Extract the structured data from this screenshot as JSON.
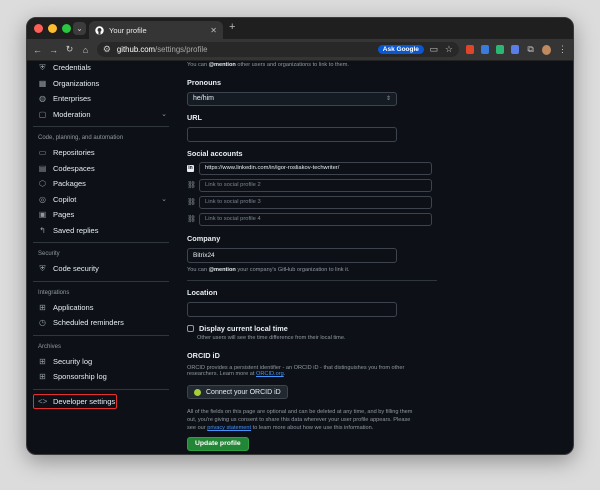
{
  "browser": {
    "tab_title": "Your profile",
    "url_host": "github.com",
    "url_path": "/settings/profile",
    "ask_google_label": "Ask Google"
  },
  "sidebar": {
    "top_items": [
      {
        "label": "Credentials",
        "icon": "shield-check-icon"
      },
      {
        "label": "Organizations",
        "icon": "organization-icon"
      },
      {
        "label": "Enterprises",
        "icon": "globe-icon"
      },
      {
        "label": "Moderation",
        "icon": "report-icon"
      }
    ],
    "heading_code": "Code, planning, and automation",
    "code_items": [
      {
        "label": "Repositories",
        "icon": "repo-icon"
      },
      {
        "label": "Codespaces",
        "icon": "codespaces-icon"
      },
      {
        "label": "Packages",
        "icon": "package-icon"
      },
      {
        "label": "Copilot",
        "icon": "copilot-icon"
      },
      {
        "label": "Pages",
        "icon": "browser-icon"
      },
      {
        "label": "Saved replies",
        "icon": "reply-icon"
      }
    ],
    "heading_security": "Security",
    "security_items": [
      {
        "label": "Code security",
        "icon": "shield-icon"
      }
    ],
    "heading_integrations": "Integrations",
    "integration_items": [
      {
        "label": "Applications",
        "icon": "apps-icon"
      },
      {
        "label": "Scheduled reminders",
        "icon": "clock-icon"
      }
    ],
    "heading_archives": "Archives",
    "archive_items": [
      {
        "label": "Security log",
        "icon": "log-icon"
      },
      {
        "label": "Sponsorship log",
        "icon": "log-icon"
      }
    ],
    "developer_settings": "Developer settings"
  },
  "profile": {
    "mention_hint_prefix": "You can",
    "mention_hint_bold": "@mention",
    "mention_hint_suffix": "other users and organizations to link to them.",
    "pronouns_label": "Pronouns",
    "pronouns_value": "he/him",
    "url_label": "URL",
    "url_value": "",
    "social_label": "Social accounts",
    "social_accounts": [
      {
        "value": "https://www.linkedin.com/in/igor-rosliakov-techwriter/",
        "placeholder": ""
      },
      {
        "value": "",
        "placeholder": "Link to social profile 2"
      },
      {
        "value": "",
        "placeholder": "Link to social profile 3"
      },
      {
        "value": "",
        "placeholder": "Link to social profile 4"
      }
    ],
    "company_label": "Company",
    "company_value": "Bitrix24",
    "company_hint_prefix": "You can",
    "company_hint_bold": "@mention",
    "company_hint_suffix": "your company's GitHub organization to link it.",
    "location_label": "Location",
    "location_value": "",
    "local_time_label": "Display current local time",
    "local_time_hint": "Other users will see the time difference from their local time.",
    "orcid_heading": "ORCID iD",
    "orcid_desc_1": "ORCID provides a persistent identifier - an ORCID iD - that distinguishes you from other",
    "orcid_desc_2": "researchers. Learn more at",
    "orcid_link": "ORCID.org",
    "orcid_button": "Connect your ORCID iD",
    "footer_1": "All of the fields on this page are optional and can be deleted at any time, and by filling them",
    "footer_2": "out, you're giving us consent to share this data wherever your user profile appears. Please",
    "footer_3_prefix": "see our",
    "footer_3_link": "privacy statement",
    "footer_3_suffix": "to learn more about how we use this information.",
    "update_button": "Update profile"
  },
  "colors": {
    "bg": "#0d1117",
    "accent_green": "#238636",
    "link": "#4493f8",
    "highlight_red": "#e5302e"
  }
}
